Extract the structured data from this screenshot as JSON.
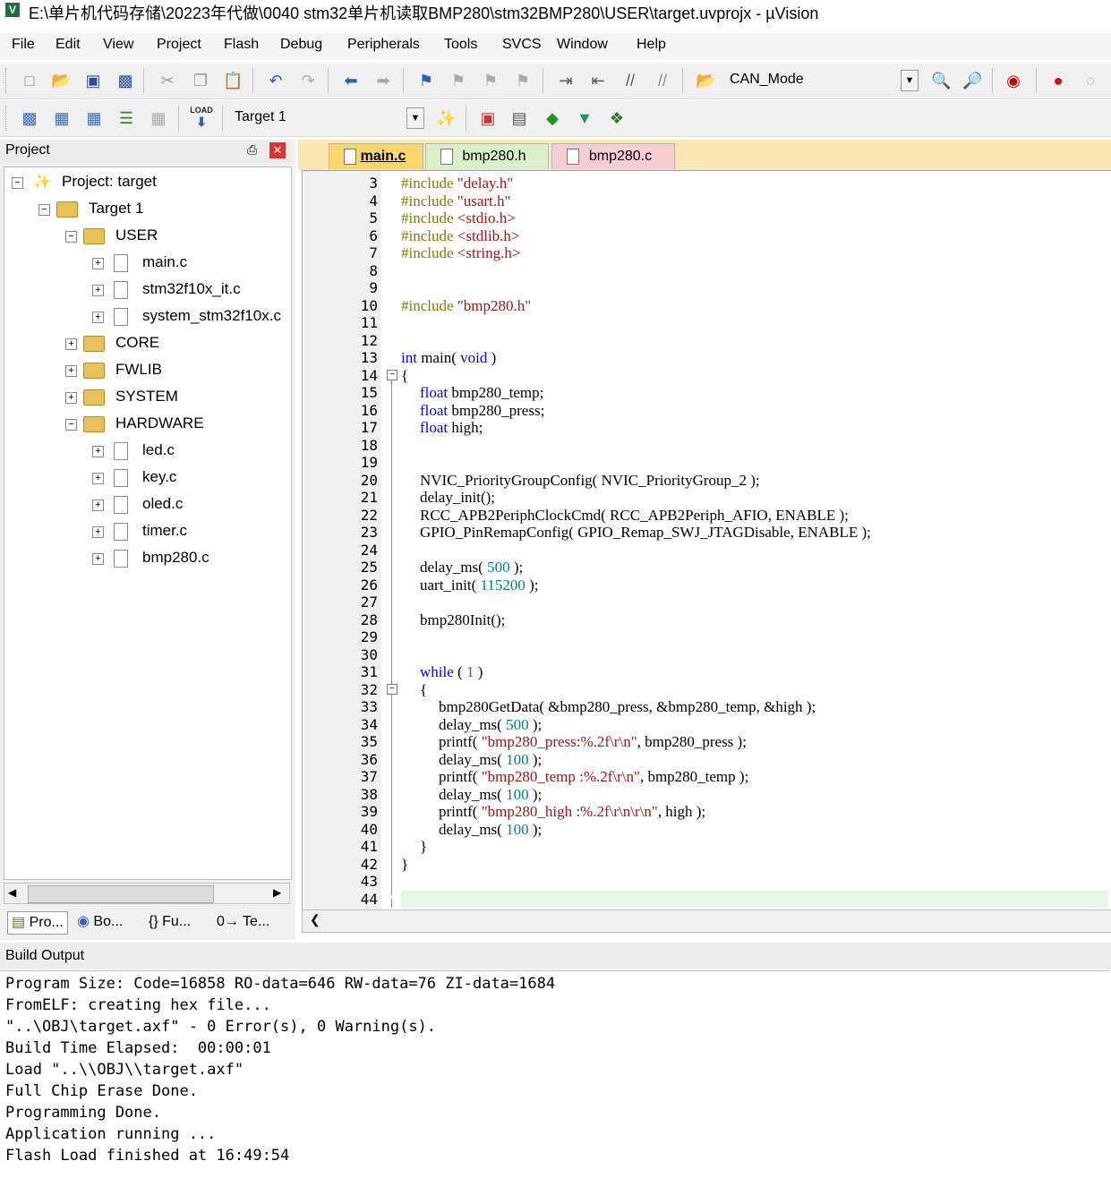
{
  "window": {
    "title": "E:\\单片机代码存储\\20223年代做\\0040 stm32单片机读取BMP280\\stm32BMP280\\USER\\target.uvprojx - µVision"
  },
  "menu": [
    "File",
    "Edit",
    "View",
    "Project",
    "Flash",
    "Debug",
    "Peripherals",
    "Tools",
    "SVCS",
    "Window",
    "Help"
  ],
  "toolbar": {
    "target_combo": "CAN_Mode",
    "build_target": "Target 1",
    "load_label": "LOAD"
  },
  "project": {
    "header": "Project",
    "root": "Project: target",
    "target": "Target 1",
    "groups": {
      "user": "USER",
      "user_files": [
        "main.c",
        "stm32f10x_it.c",
        "system_stm32f10x.c"
      ],
      "core": "CORE",
      "fwlib": "FWLIB",
      "system": "SYSTEM",
      "hardware": "HARDWARE",
      "hardware_files": [
        "led.c",
        "key.c",
        "oled.c",
        "timer.c",
        "bmp280.c"
      ]
    },
    "bottom_tabs": [
      "Pro...",
      "Bo...",
      "{} Fu...",
      "0→ Te..."
    ]
  },
  "editor": {
    "tabs": [
      "main.c",
      "bmp280.h",
      "bmp280.c"
    ],
    "active_tab": "main.c",
    "line_numbers": [
      "3",
      "4",
      "5",
      "6",
      "7",
      "8",
      "9",
      "10",
      "11",
      "12",
      "13",
      "14",
      "15",
      "16",
      "17",
      "18",
      "19",
      "20",
      "21",
      "22",
      "23",
      "24",
      "25",
      "26",
      "27",
      "28",
      "29",
      "30",
      "31",
      "32",
      "33",
      "34",
      "35",
      "36",
      "37",
      "38",
      "39",
      "40",
      "41",
      "42",
      "43",
      "44"
    ],
    "code": {
      "l3_inc": "#include",
      "l3_str": "\"delay.h\"",
      "l4_inc": "#include",
      "l4_str": "\"usart.h\"",
      "l5_inc": "#include",
      "l5_str": "<stdio.h>",
      "l6_inc": "#include",
      "l6_str": "<stdlib.h>",
      "l7_inc": "#include",
      "l7_str": "<string.h>",
      "l10_inc": "#include",
      "l10_str": "\"bmp280.h\"",
      "l13_kw1": "int",
      "l13_mid": " main( ",
      "l13_kw2": "void",
      "l13_end": " )",
      "l14": "{",
      "l15_kw": "float",
      "l15_rest": " bmp280_temp;",
      "l16_kw": "float",
      "l16_rest": " bmp280_press;",
      "l17_kw": "float",
      "l17_rest": " high;",
      "l20": "NVIC_PriorityGroupConfig( NVIC_PriorityGroup_2 );",
      "l21": "delay_init();",
      "l22": "RCC_APB2PeriphClockCmd( RCC_APB2Periph_AFIO, ENABLE );",
      "l23": "GPIO_PinRemapConfig( GPIO_Remap_SWJ_JTAGDisable, ENABLE );",
      "l25_a": "delay_ms( ",
      "l25_n": "500",
      "l25_b": " );",
      "l26_a": "uart_init( ",
      "l26_n": "115200",
      "l26_b": " );",
      "l28": "bmp280Init();",
      "l31_kw": "while",
      "l31_a": " ( ",
      "l31_n": "1",
      "l31_b": " )",
      "l32": "{",
      "l33": "bmp280GetData( &bmp280_press, &bmp280_temp, &high );",
      "l34_a": "delay_ms( ",
      "l34_n": "500",
      "l34_b": " );",
      "l35_a": "printf( ",
      "l35_s": "\"bmp280_press:%.2f\\r\\n\"",
      "l35_b": ", bmp280_press );",
      "l36_a": "delay_ms( ",
      "l36_n": "100",
      "l36_b": " );",
      "l37_a": "printf( ",
      "l37_s": "\"bmp280_temp :%.2f\\r\\n\"",
      "l37_b": ", bmp280_temp );",
      "l38_a": "delay_ms( ",
      "l38_n": "100",
      "l38_b": " );",
      "l39_a": "printf( ",
      "l39_s": "\"bmp280_high :%.2f\\r\\n\\r\\n\"",
      "l39_b": ", high );",
      "l40_a": "delay_ms( ",
      "l40_n": "100",
      "l40_b": " );",
      "l41": "}",
      "l42": "}"
    }
  },
  "build_output": {
    "header": "Build Output",
    "lines": [
      "Program Size: Code=16858 RO-data=646 RW-data=76 ZI-data=1684",
      "FromELF: creating hex file...",
      "\"..\\OBJ\\target.axf\" - 0 Error(s), 0 Warning(s).",
      "Build Time Elapsed:  00:00:01",
      "Load \"..\\\\OBJ\\\\target.axf\"",
      "Full Chip Erase Done.",
      "Programming Done.",
      "Application running ...",
      "Flash Load finished at 16:49:54"
    ]
  }
}
